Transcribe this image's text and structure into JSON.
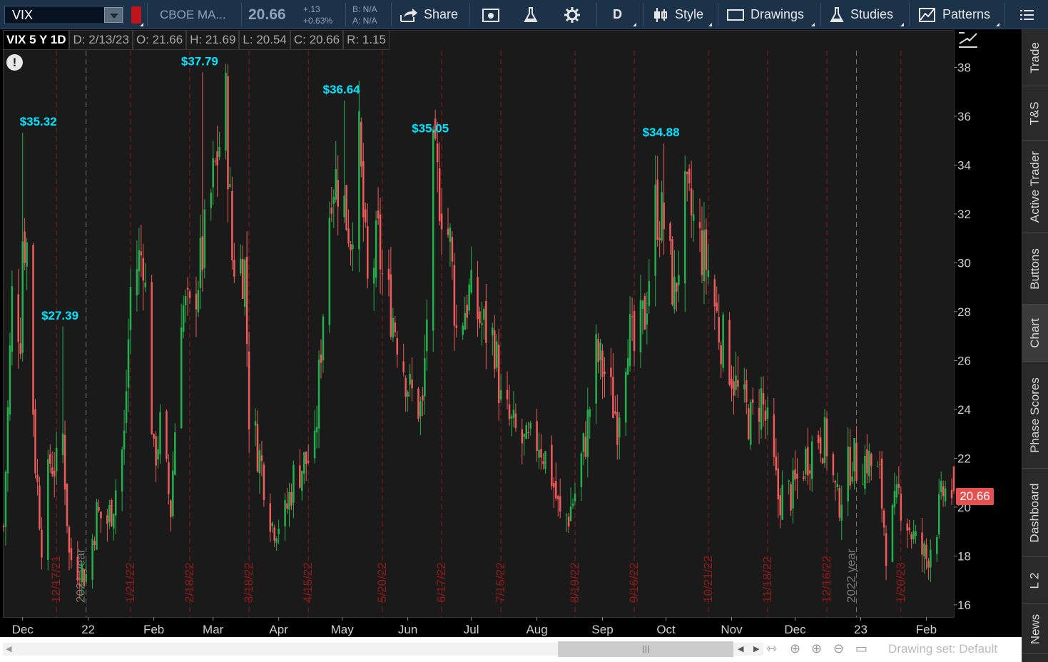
{
  "toolbar": {
    "symbol": "VIX",
    "description": "CBOE MA...",
    "last": "20.66",
    "change": "+.13",
    "change_pct": "+0.63%",
    "bid": "B: N/A",
    "ask": "A: N/A",
    "share_label": "Share",
    "period_label": "D",
    "style_label": "Style",
    "drawings_label": "Drawings",
    "studies_label": "Studies",
    "patterns_label": "Patterns"
  },
  "header": {
    "symbol_period": "VIX 5 Y 1D",
    "date": "D: 2/13/23",
    "open": "O: 21.66",
    "high": "H: 21.69",
    "low": "L: 20.54",
    "close": "C: 20.66",
    "range": "R: 1.15"
  },
  "sidebar": {
    "tabs": [
      "Trade",
      "T&S",
      "Active Trader",
      "Buttons",
      "Chart",
      "Phase Scores",
      "Dashboard",
      "L 2",
      "News"
    ]
  },
  "footer": {
    "drawing_set": "Drawing set: Default"
  },
  "colors": {
    "up": "#22b14c",
    "down": "#f05a5a",
    "annotation": "#00e5ff",
    "price_tag": "#e84f4f",
    "week_line": "#8b1a1a",
    "year_line": "#777777"
  },
  "chart_data": {
    "type": "candlestick",
    "title": "VIX 5 Y 1D",
    "ylim": [
      15.5,
      39.5
    ],
    "y_ticks": [
      16,
      18,
      20,
      22,
      24,
      26,
      28,
      30,
      32,
      34,
      36,
      38
    ],
    "x_month_labels": [
      "Dec",
      "22",
      "Feb",
      "Mar",
      "Apr",
      "May",
      "Jun",
      "Jul",
      "Aug",
      "Sep",
      "Oct",
      "Nov",
      "Dec",
      "23",
      "Feb"
    ],
    "x_month_dates": [
      "2021-12-01",
      "2022-01-01",
      "2022-02-01",
      "2022-03-01",
      "2022-04-01",
      "2022-05-01",
      "2022-06-01",
      "2022-07-01",
      "2022-08-01",
      "2022-09-01",
      "2022-10-01",
      "2022-11-01",
      "2022-12-01",
      "2023-01-01",
      "2023-02-01"
    ],
    "x_range": [
      "2021-11-22",
      "2023-02-14"
    ],
    "vertical_date_labels": [
      "12/17/21",
      "1/21/22",
      "2/18/22",
      "3/18/22",
      "4/15/22",
      "5/20/22",
      "6/17/22",
      "7/15/22",
      "8/19/22",
      "9/16/22",
      "10/21/22",
      "11/18/22",
      "12/16/22",
      "1/20/23"
    ],
    "vertical_date_dates": [
      "2021-12-17",
      "2022-01-21",
      "2022-02-18",
      "2022-03-18",
      "2022-04-15",
      "2022-05-20",
      "2022-06-17",
      "2022-07-15",
      "2022-08-19",
      "2022-09-16",
      "2022-10-21",
      "2022-11-18",
      "2022-12-16",
      "2023-01-20"
    ],
    "year_markers": [
      {
        "label": "2021 year",
        "date": "2021-12-31"
      },
      {
        "label": "2022 year",
        "date": "2022-12-30"
      }
    ],
    "annotations": [
      {
        "label": "$35.32",
        "date": "2021-12-01",
        "value": 35.32
      },
      {
        "label": "$27.39",
        "date": "2021-12-20",
        "value": 27.39
      },
      {
        "label": "$37.79",
        "date": "2022-02-24",
        "value": 37.79
      },
      {
        "label": "$36.64",
        "date": "2022-05-02",
        "value": 36.64
      },
      {
        "label": "$35.05",
        "date": "2022-06-13",
        "value": 35.05
      },
      {
        "label": "$34.88",
        "date": "2022-09-30",
        "value": 34.88
      }
    ],
    "last_price": "20.66",
    "close_series": [
      {
        "date": "2021-11-22",
        "close": 19.2
      },
      {
        "date": "2021-11-26",
        "close": 28.6
      },
      {
        "date": "2021-11-30",
        "close": 27.2
      },
      {
        "date": "2021-12-01",
        "close": 31.1
      },
      {
        "date": "2021-12-03",
        "close": 30.7
      },
      {
        "date": "2021-12-07",
        "close": 21.9
      },
      {
        "date": "2021-12-10",
        "close": 18.7
      },
      {
        "date": "2021-12-14",
        "close": 21.9
      },
      {
        "date": "2021-12-17",
        "close": 21.6
      },
      {
        "date": "2021-12-20",
        "close": 22.9
      },
      {
        "date": "2021-12-23",
        "close": 18.0
      },
      {
        "date": "2021-12-28",
        "close": 17.5
      },
      {
        "date": "2021-12-31",
        "close": 17.2
      },
      {
        "date": "2022-01-05",
        "close": 19.7
      },
      {
        "date": "2022-01-10",
        "close": 19.4
      },
      {
        "date": "2022-01-13",
        "close": 20.3
      },
      {
        "date": "2022-01-18",
        "close": 22.8
      },
      {
        "date": "2022-01-21",
        "close": 28.9
      },
      {
        "date": "2022-01-24",
        "close": 29.9
      },
      {
        "date": "2022-01-27",
        "close": 30.5
      },
      {
        "date": "2022-02-01",
        "close": 21.9
      },
      {
        "date": "2022-02-04",
        "close": 23.2
      },
      {
        "date": "2022-02-09",
        "close": 19.9
      },
      {
        "date": "2022-02-14",
        "close": 28.3
      },
      {
        "date": "2022-02-18",
        "close": 27.8
      },
      {
        "date": "2022-02-24",
        "close": 30.3
      },
      {
        "date": "2022-03-01",
        "close": 33.3
      },
      {
        "date": "2022-03-07",
        "close": 36.5
      },
      {
        "date": "2022-03-10",
        "close": 30.2
      },
      {
        "date": "2022-03-16",
        "close": 29.8
      },
      {
        "date": "2022-03-18",
        "close": 23.9
      },
      {
        "date": "2022-03-24",
        "close": 21.7
      },
      {
        "date": "2022-03-29",
        "close": 19.3
      },
      {
        "date": "2022-04-04",
        "close": 19.6
      },
      {
        "date": "2022-04-08",
        "close": 21.2
      },
      {
        "date": "2022-04-13",
        "close": 21.8
      },
      {
        "date": "2022-04-18",
        "close": 22.2
      },
      {
        "date": "2022-04-22",
        "close": 28.2
      },
      {
        "date": "2022-04-26",
        "close": 33.5
      },
      {
        "date": "2022-04-29",
        "close": 33.4
      },
      {
        "date": "2022-05-05",
        "close": 31.2
      },
      {
        "date": "2022-05-09",
        "close": 34.8
      },
      {
        "date": "2022-05-13",
        "close": 28.9
      },
      {
        "date": "2022-05-18",
        "close": 30.9
      },
      {
        "date": "2022-05-20",
        "close": 29.4
      },
      {
        "date": "2022-05-26",
        "close": 27.5
      },
      {
        "date": "2022-06-02",
        "close": 24.7
      },
      {
        "date": "2022-06-08",
        "close": 23.9
      },
      {
        "date": "2022-06-13",
        "close": 34.0
      },
      {
        "date": "2022-06-16",
        "close": 32.9
      },
      {
        "date": "2022-06-21",
        "close": 30.8
      },
      {
        "date": "2022-06-24",
        "close": 27.2
      },
      {
        "date": "2022-06-30",
        "close": 28.7
      },
      {
        "date": "2022-07-06",
        "close": 27.5
      },
      {
        "date": "2022-07-12",
        "close": 26.8
      },
      {
        "date": "2022-07-15",
        "close": 24.2
      },
      {
        "date": "2022-07-21",
        "close": 23.1
      },
      {
        "date": "2022-07-27",
        "close": 22.4
      },
      {
        "date": "2022-08-02",
        "close": 22.8
      },
      {
        "date": "2022-08-08",
        "close": 21.3
      },
      {
        "date": "2022-08-12",
        "close": 19.5
      },
      {
        "date": "2022-08-16",
        "close": 19.7
      },
      {
        "date": "2022-08-19",
        "close": 20.6
      },
      {
        "date": "2022-08-24",
        "close": 22.8
      },
      {
        "date": "2022-08-29",
        "close": 26.2
      },
      {
        "date": "2022-09-02",
        "close": 25.5
      },
      {
        "date": "2022-09-08",
        "close": 23.6
      },
      {
        "date": "2022-09-13",
        "close": 27.3
      },
      {
        "date": "2022-09-16",
        "close": 26.3
      },
      {
        "date": "2022-09-21",
        "close": 27.9
      },
      {
        "date": "2022-09-26",
        "close": 32.3
      },
      {
        "date": "2022-09-30",
        "close": 31.6
      },
      {
        "date": "2022-10-05",
        "close": 28.6
      },
      {
        "date": "2022-10-10",
        "close": 32.4
      },
      {
        "date": "2022-10-13",
        "close": 31.9
      },
      {
        "date": "2022-10-18",
        "close": 30.5
      },
      {
        "date": "2022-10-21",
        "close": 29.7
      },
      {
        "date": "2022-10-26",
        "close": 27.3
      },
      {
        "date": "2022-10-31",
        "close": 25.9
      },
      {
        "date": "2022-11-04",
        "close": 24.6
      },
      {
        "date": "2022-11-10",
        "close": 23.5
      },
      {
        "date": "2022-11-15",
        "close": 24.5
      },
      {
        "date": "2022-11-18",
        "close": 23.1
      },
      {
        "date": "2022-11-23",
        "close": 20.4
      },
      {
        "date": "2022-11-30",
        "close": 20.6
      },
      {
        "date": "2022-12-06",
        "close": 22.0
      },
      {
        "date": "2022-12-12",
        "close": 23.0
      },
      {
        "date": "2022-12-16",
        "close": 22.6
      },
      {
        "date": "2022-12-21",
        "close": 20.1
      },
      {
        "date": "2022-12-28",
        "close": 22.1
      },
      {
        "date": "2022-12-30",
        "close": 21.7
      },
      {
        "date": "2023-01-04",
        "close": 22.0
      },
      {
        "date": "2023-01-10",
        "close": 21.1
      },
      {
        "date": "2023-01-13",
        "close": 18.4
      },
      {
        "date": "2023-01-19",
        "close": 20.5
      },
      {
        "date": "2023-01-24",
        "close": 19.2
      },
      {
        "date": "2023-01-27",
        "close": 18.5
      },
      {
        "date": "2023-02-01",
        "close": 17.9
      },
      {
        "date": "2023-02-06",
        "close": 19.4
      },
      {
        "date": "2023-02-09",
        "close": 20.6
      },
      {
        "date": "2023-02-13",
        "close": 20.66
      }
    ]
  }
}
